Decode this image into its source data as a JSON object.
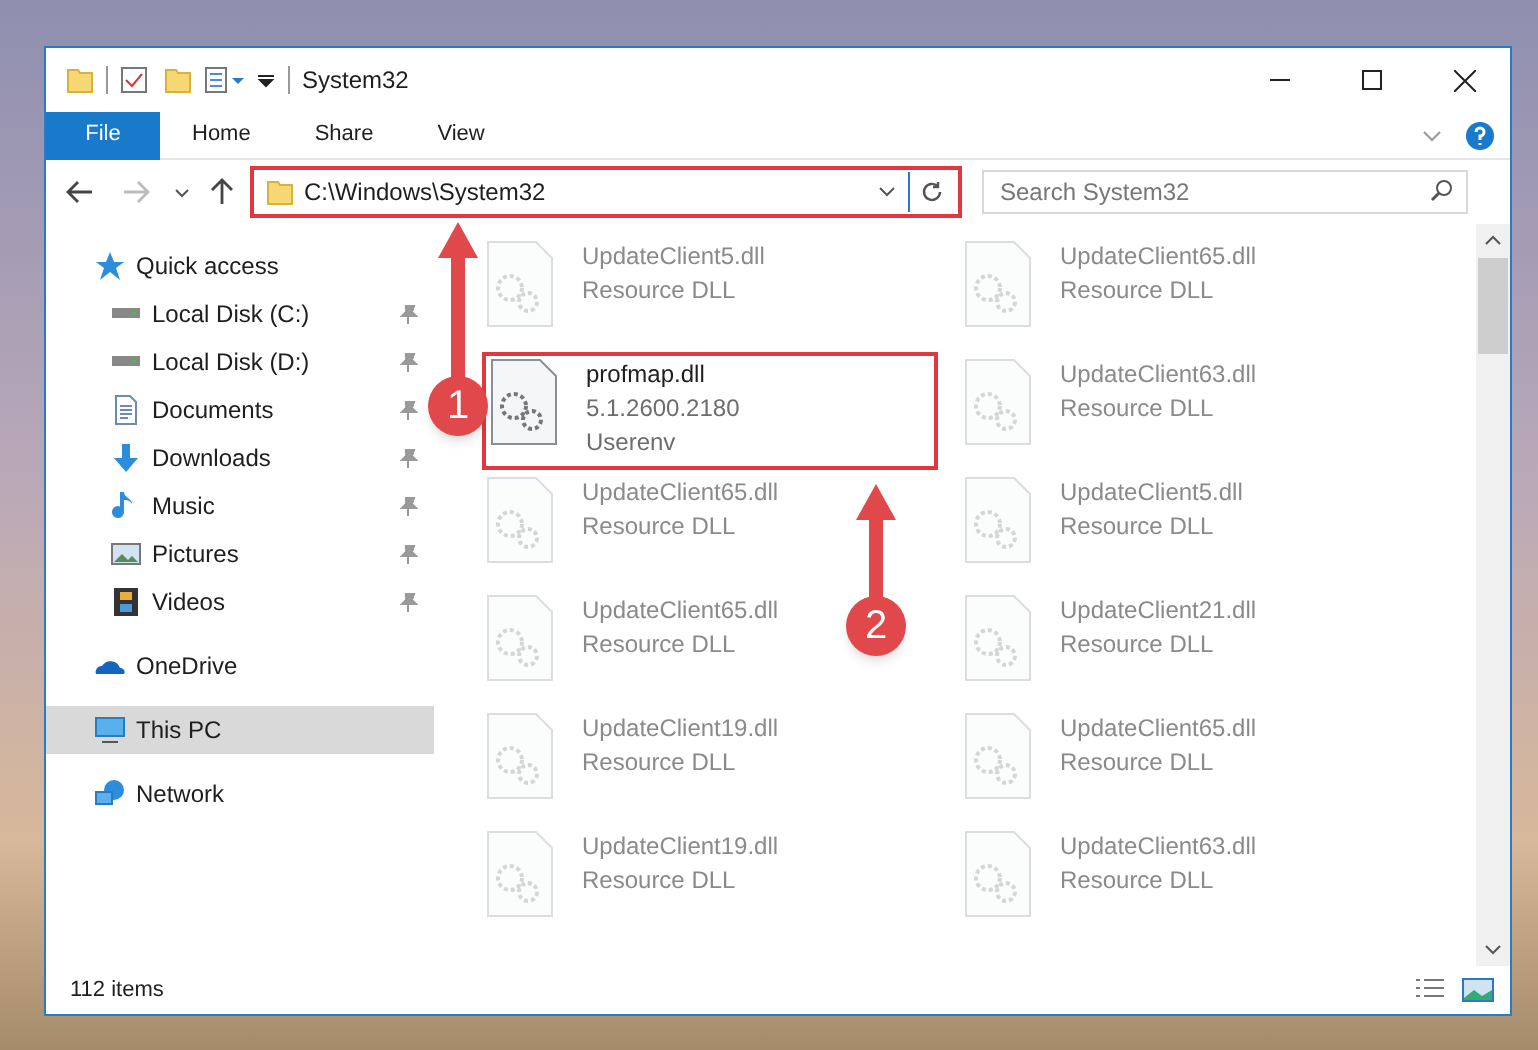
{
  "window": {
    "title": "System32"
  },
  "ribbon_tabs": [
    {
      "label": "File",
      "selected": true
    },
    {
      "label": "Home",
      "selected": false
    },
    {
      "label": "Share",
      "selected": false
    },
    {
      "label": "View",
      "selected": false
    }
  ],
  "address": {
    "path": "C:\\Windows\\System32",
    "highlighted": true
  },
  "search": {
    "placeholder": "Search System32"
  },
  "sidebar": {
    "items": [
      {
        "label": "Quick access",
        "selected": false,
        "pinned": false,
        "children": [
          {
            "label": "Local Disk (C:)",
            "selected": false,
            "pinned": true
          },
          {
            "label": "Local Disk (D:)",
            "selected": false,
            "pinned": true
          },
          {
            "label": "Documents",
            "selected": false,
            "pinned": true
          },
          {
            "label": "Downloads",
            "selected": false,
            "pinned": true
          },
          {
            "label": "Music",
            "selected": false,
            "pinned": true
          },
          {
            "label": "Pictures",
            "selected": false,
            "pinned": true
          },
          {
            "label": "Videos",
            "selected": false,
            "pinned": true
          }
        ]
      },
      {
        "label": "OneDrive",
        "selected": false,
        "pinned": false
      },
      {
        "label": "This PC",
        "selected": true,
        "pinned": false
      },
      {
        "label": "Network",
        "selected": false,
        "pinned": false
      }
    ]
  },
  "files": [
    {
      "lines": [
        "UpdateClient5.dll",
        "Resource DLL"
      ],
      "blurred": true
    },
    {
      "lines": [
        "UpdateClient65.dll",
        "Resource DLL"
      ],
      "blurred": true
    },
    {
      "lines": [
        "profmap.dll",
        "5.1.2600.2180",
        "Userenv"
      ],
      "blurred": false,
      "highlighted": true
    },
    {
      "lines": [
        "UpdateClient63.dll",
        "Resource DLL"
      ],
      "blurred": true
    },
    {
      "lines": [
        "UpdateClient65.dll",
        "Resource DLL"
      ],
      "blurred": true
    },
    {
      "lines": [
        "UpdateClient5.dll",
        "Resource DLL"
      ],
      "blurred": true
    },
    {
      "lines": [
        "UpdateClient65.dll",
        "Resource DLL"
      ],
      "blurred": true
    },
    {
      "lines": [
        "UpdateClient21.dll",
        "Resource DLL"
      ],
      "blurred": true
    },
    {
      "lines": [
        "UpdateClient19.dll",
        "Resource DLL"
      ],
      "blurred": true
    },
    {
      "lines": [
        "UpdateClient65.dll",
        "Resource DLL"
      ],
      "blurred": true
    },
    {
      "lines": [
        "UpdateClient19.dll",
        "Resource DLL"
      ],
      "blurred": true
    },
    {
      "lines": [
        "UpdateClient63.dll",
        "Resource DLL"
      ],
      "blurred": true
    }
  ],
  "status_bar": {
    "count": "112 items"
  },
  "annotations": [
    {
      "number": "1"
    },
    {
      "number": "2"
    }
  ]
}
